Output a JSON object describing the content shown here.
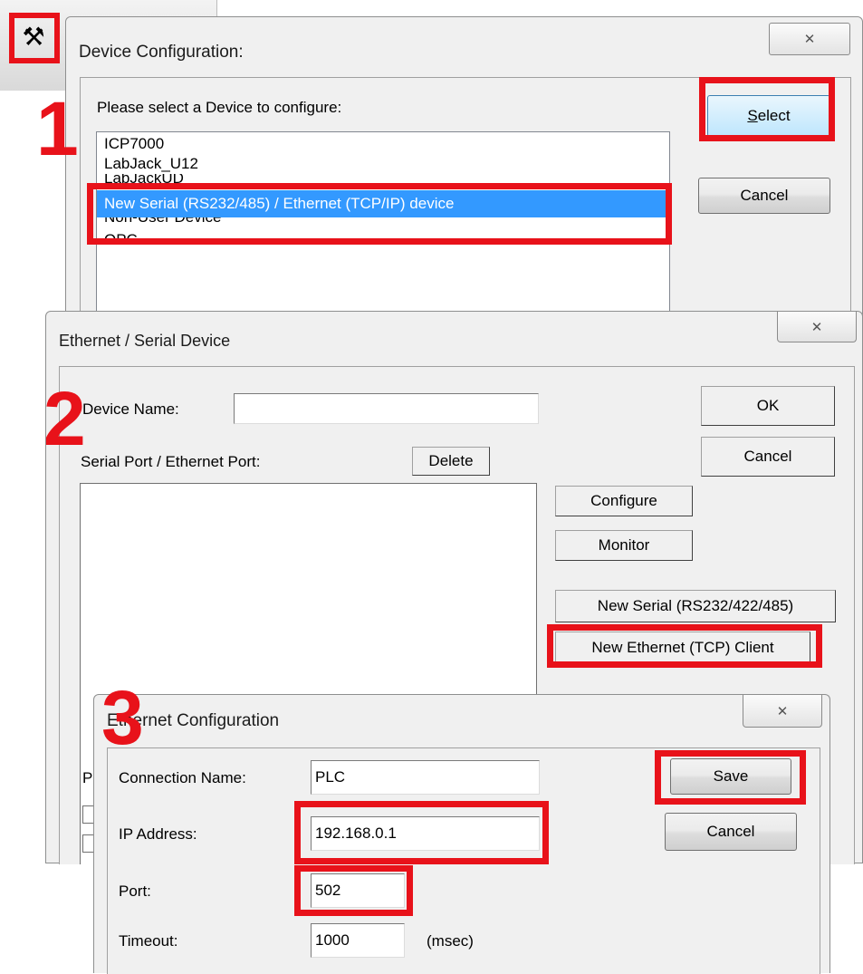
{
  "device_config": {
    "title": "Device Configuration:",
    "prompt": "Please select a Device to configure:",
    "select_prefix": "S",
    "select_rest": "elect",
    "cancel_label": "Cancel",
    "close_glyph": "✕",
    "items": [
      "ICP7000",
      "LabJack_U12",
      "LabJackUD",
      "New Serial (RS232/485) / Ethernet (TCP/IP) device",
      "Non-User Device",
      "OPC"
    ],
    "selected_index": 3
  },
  "ethernet_serial": {
    "title": "Ethernet / Serial Device",
    "close_glyph": "✕",
    "device_name_label": "Device Name:",
    "device_name_value": "",
    "port_label": "Serial Port / Ethernet Port:",
    "delete_label": "Delete",
    "ok_label": "OK",
    "cancel_label": "Cancel",
    "configure_label": "Configure",
    "monitor_label": "Monitor",
    "new_serial_label": "New Serial (RS232/422/485)",
    "new_ethernet_label": "New Ethernet (TCP) Client",
    "partial_label": "Pr"
  },
  "ethernet_config": {
    "title": "Ethernet Configuration",
    "close_glyph": "✕",
    "connection_name_label": "Connection Name:",
    "connection_name_value": "PLC",
    "ip_label": "IP Address:",
    "ip_value": "192.168.0.1",
    "port_label": "Port:",
    "port_value": "502",
    "timeout_label": "Timeout:",
    "timeout_value": "1000",
    "timeout_unit": "(msec)",
    "save_label": "Save",
    "cancel_label": "Cancel"
  },
  "steps": [
    "1",
    "2",
    "3"
  ],
  "colors": {
    "highlight": "#e8121a",
    "selection": "#3399ff"
  }
}
